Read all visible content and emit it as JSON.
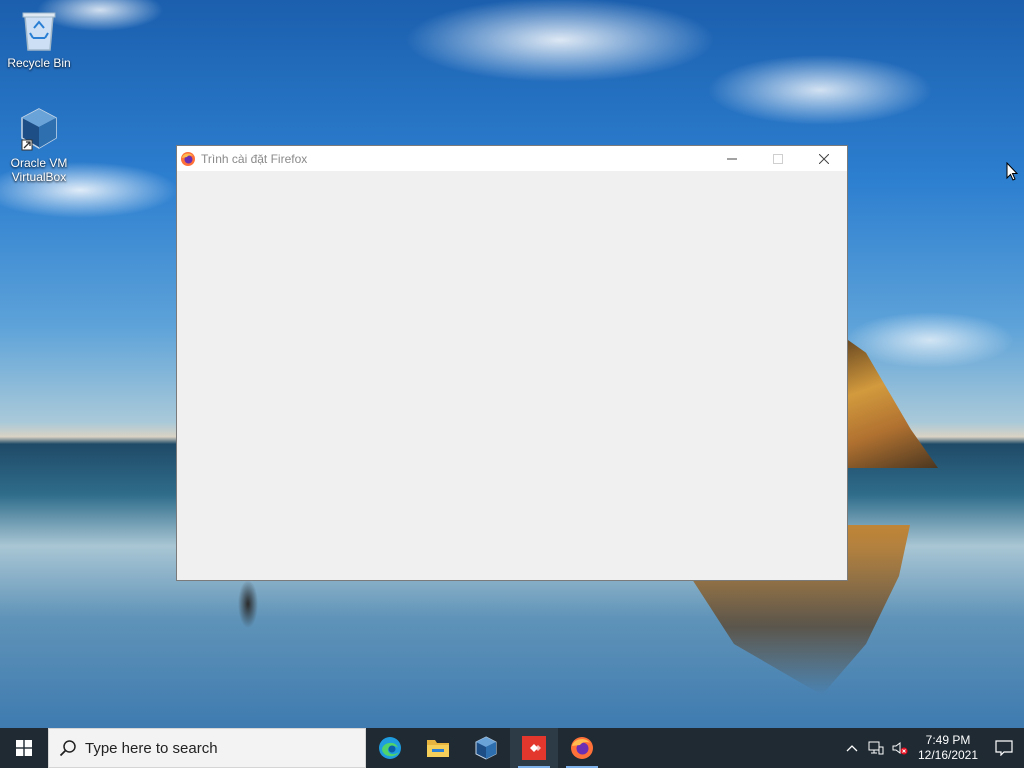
{
  "desktop": {
    "icons": [
      {
        "label": "Recycle Bin",
        "icon": "recycle-bin-icon"
      },
      {
        "label": "Oracle VM VirtualBox",
        "icon": "virtualbox-icon"
      }
    ]
  },
  "window": {
    "title": "Trình cài đặt Firefox",
    "icon": "firefox-icon",
    "controls": [
      "minimize",
      "maximize",
      "close"
    ]
  },
  "taskbar": {
    "search_placeholder": "Type here to search",
    "apps": [
      {
        "name": "Microsoft Edge",
        "icon": "edge-icon"
      },
      {
        "name": "File Explorer",
        "icon": "folder-icon"
      },
      {
        "name": "Oracle VM VirtualBox",
        "icon": "virtualbox-icon"
      },
      {
        "name": "AnyDesk",
        "icon": "anydesk-icon"
      },
      {
        "name": "Firefox Installer",
        "icon": "firefox-icon"
      }
    ],
    "clock": {
      "time": "7:49 PM",
      "date": "12/16/2021"
    }
  },
  "colors": {
    "taskbar_bg": "#1f2a33",
    "window_bg": "#f0f0f0",
    "accent": "#7fb2ea"
  }
}
